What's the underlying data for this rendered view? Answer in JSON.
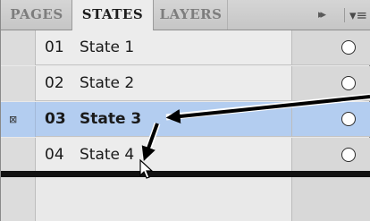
{
  "tabs": {
    "pages": "PAGES",
    "states": "STATES",
    "layers": "LAYERS"
  },
  "tab_icons": {
    "fast_forward": "fast-forward-icon",
    "panel_menu": "panel-menu-icon"
  },
  "states": [
    {
      "number": "01",
      "name": "State 1",
      "selected": false
    },
    {
      "number": "02",
      "name": "State 2",
      "selected": false
    },
    {
      "number": "03",
      "name": "State 3",
      "selected": true
    },
    {
      "number": "04",
      "name": "State 4",
      "selected": false
    }
  ],
  "colors": {
    "selection": "#b3cdf0",
    "drop_line": "#111111",
    "annotation_arrow": "#000000"
  }
}
